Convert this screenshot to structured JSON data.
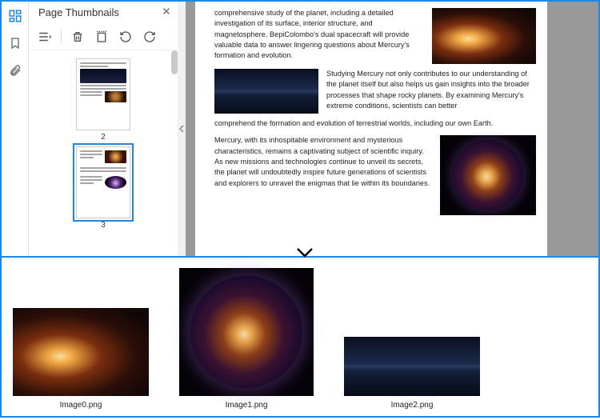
{
  "sidebar": {
    "title": "Page Thumbnails",
    "thumbs": [
      {
        "num": "2"
      },
      {
        "num": "3"
      }
    ]
  },
  "doc": {
    "p1": "comprehensive study of the planet, including a detailed investigation of its surface, interior structure, and magnetosphere. BepiColombo's dual spacecraft will provide valuable data to answer lingering questions about Mercury's formation and evolution.",
    "p2a": "Studying Mercury not only contributes to our understanding of the planet itself but also helps us gain insights into the broader processes that shape rocky planets. By examining Mercury's extreme conditions, scientists can better",
    "p2b": "comprehend the formation and evolution of terrestrial worlds, including our own Earth.",
    "p3": "Mercury, with its inhospitable environment and mysterious characteristics, remains a captivating subject of scientific inquiry. As new missions and technologies continue to unveil its secrets, the planet will undoubtedly inspire future generations of scientists and explorers to unravel the enigmas that lie within its boundaries."
  },
  "extracted": {
    "items": [
      {
        "label": "Image0.png"
      },
      {
        "label": "Image1.png"
      },
      {
        "label": "Image2.png"
      }
    ]
  }
}
